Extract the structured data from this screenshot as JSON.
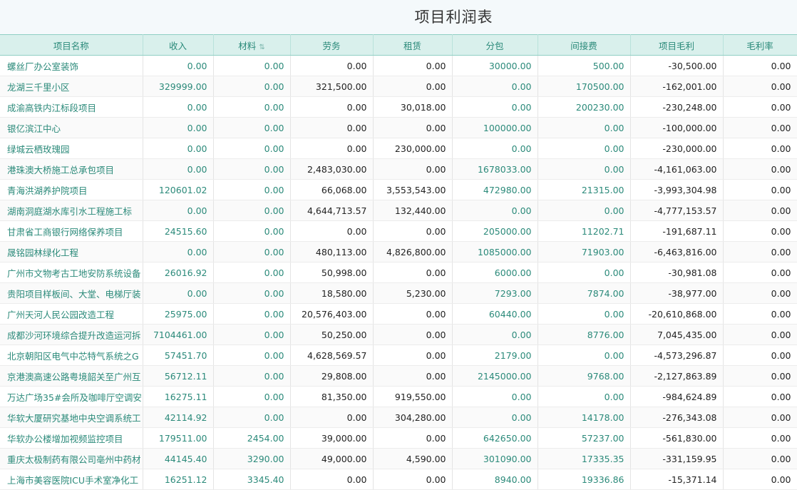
{
  "page": {
    "title": "项目利润表"
  },
  "columns": [
    {
      "key": "name",
      "label": "项目名称"
    },
    {
      "key": "income",
      "label": "收入"
    },
    {
      "key": "material",
      "label": "材料",
      "sort_icon": "sort-icon"
    },
    {
      "key": "labor",
      "label": "劳务"
    },
    {
      "key": "lease",
      "label": "租赁"
    },
    {
      "key": "subcontract",
      "label": "分包"
    },
    {
      "key": "indirect",
      "label": "间接费"
    },
    {
      "key": "gross",
      "label": "项目毛利"
    },
    {
      "key": "margin",
      "label": "毛利率"
    }
  ],
  "rows": [
    {
      "name": "螺丝厂办公室装饰",
      "income": "0.00",
      "material": "0.00",
      "labor": "0.00",
      "lease": "0.00",
      "subcontract": "30000.00",
      "indirect": "500.00",
      "gross": "-30,500.00",
      "margin": "0.00"
    },
    {
      "name": "龙湖三千里小区",
      "income": "329999.00",
      "material": "0.00",
      "labor": "321,500.00",
      "lease": "0.00",
      "subcontract": "0.00",
      "indirect": "170500.00",
      "gross": "-162,001.00",
      "margin": "0.00"
    },
    {
      "name": "成渝高铁内江标段项目",
      "income": "0.00",
      "material": "0.00",
      "labor": "0.00",
      "lease": "30,018.00",
      "subcontract": "0.00",
      "indirect": "200230.00",
      "gross": "-230,248.00",
      "margin": "0.00"
    },
    {
      "name": "银亿滨江中心",
      "income": "0.00",
      "material": "0.00",
      "labor": "0.00",
      "lease": "0.00",
      "subcontract": "100000.00",
      "indirect": "0.00",
      "gross": "-100,000.00",
      "margin": "0.00"
    },
    {
      "name": "绿城云栖玫瑰园",
      "income": "0.00",
      "material": "0.00",
      "labor": "0.00",
      "lease": "230,000.00",
      "subcontract": "0.00",
      "indirect": "0.00",
      "gross": "-230,000.00",
      "margin": "0.00"
    },
    {
      "name": "港珠澳大桥施工总承包项目",
      "income": "0.00",
      "material": "0.00",
      "labor": "2,483,030.00",
      "lease": "0.00",
      "subcontract": "1678033.00",
      "indirect": "0.00",
      "gross": "-4,161,063.00",
      "margin": "0.00"
    },
    {
      "name": "青海洪湖养护院项目",
      "income": "120601.02",
      "material": "0.00",
      "labor": "66,068.00",
      "lease": "3,553,543.00",
      "subcontract": "472980.00",
      "indirect": "21315.00",
      "gross": "-3,993,304.98",
      "margin": "0.00"
    },
    {
      "name": "湖南洞庭湖水库引水工程施工标",
      "income": "0.00",
      "material": "0.00",
      "labor": "4,644,713.57",
      "lease": "132,440.00",
      "subcontract": "0.00",
      "indirect": "0.00",
      "gross": "-4,777,153.57",
      "margin": "0.00"
    },
    {
      "name": "甘肃省工商银行网络保养项目",
      "income": "24515.60",
      "material": "0.00",
      "labor": "0.00",
      "lease": "0.00",
      "subcontract": "205000.00",
      "indirect": "11202.71",
      "gross": "-191,687.11",
      "margin": "0.00"
    },
    {
      "name": "晟铭园林绿化工程",
      "income": "0.00",
      "material": "0.00",
      "labor": "480,113.00",
      "lease": "4,826,800.00",
      "subcontract": "1085000.00",
      "indirect": "71903.00",
      "gross": "-6,463,816.00",
      "margin": "0.00"
    },
    {
      "name": "广州市文物考古工地安防系统设备",
      "income": "26016.92",
      "material": "0.00",
      "labor": "50,998.00",
      "lease": "0.00",
      "subcontract": "6000.00",
      "indirect": "0.00",
      "gross": "-30,981.08",
      "margin": "0.00"
    },
    {
      "name": "贵阳项目样板间、大堂、电梯厅装",
      "income": "0.00",
      "material": "0.00",
      "labor": "18,580.00",
      "lease": "5,230.00",
      "subcontract": "7293.00",
      "indirect": "7874.00",
      "gross": "-38,977.00",
      "margin": "0.00"
    },
    {
      "name": "广州天河人民公园改造工程",
      "income": "25975.00",
      "material": "0.00",
      "labor": "20,576,403.00",
      "lease": "0.00",
      "subcontract": "60440.00",
      "indirect": "0.00",
      "gross": "-20,610,868.00",
      "margin": "0.00"
    },
    {
      "name": "成都沙河环境综合提升改造运河拆",
      "income": "7104461.00",
      "material": "0.00",
      "labor": "50,250.00",
      "lease": "0.00",
      "subcontract": "0.00",
      "indirect": "8776.00",
      "gross": "7,045,435.00",
      "margin": "0.00"
    },
    {
      "name": "北京朝阳区电气中芯特气系统之G",
      "income": "57451.70",
      "material": "0.00",
      "labor": "4,628,569.57",
      "lease": "0.00",
      "subcontract": "2179.00",
      "indirect": "0.00",
      "gross": "-4,573,296.87",
      "margin": "0.00"
    },
    {
      "name": "京港澳高速公路粤境韶关至广州互",
      "income": "56712.11",
      "material": "0.00",
      "labor": "29,808.00",
      "lease": "0.00",
      "subcontract": "2145000.00",
      "indirect": "9768.00",
      "gross": "-2,127,863.89",
      "margin": "0.00"
    },
    {
      "name": "万达广场35#会所及咖啡厅空调安",
      "income": "16275.11",
      "material": "0.00",
      "labor": "81,350.00",
      "lease": "919,550.00",
      "subcontract": "0.00",
      "indirect": "0.00",
      "gross": "-984,624.89",
      "margin": "0.00"
    },
    {
      "name": "华软大厦研究基地中央空调系统工",
      "income": "42114.92",
      "material": "0.00",
      "labor": "0.00",
      "lease": "304,280.00",
      "subcontract": "0.00",
      "indirect": "14178.00",
      "gross": "-276,343.08",
      "margin": "0.00"
    },
    {
      "name": "华软办公楼增加视频监控项目",
      "income": "179511.00",
      "material": "2454.00",
      "labor": "39,000.00",
      "lease": "0.00",
      "subcontract": "642650.00",
      "indirect": "57237.00",
      "gross": "-561,830.00",
      "margin": "0.00"
    },
    {
      "name": "重庆太极制药有限公司亳州中药材",
      "income": "44145.40",
      "material": "3290.00",
      "labor": "49,000.00",
      "lease": "4,590.00",
      "subcontract": "301090.00",
      "indirect": "17335.35",
      "gross": "-331,159.95",
      "margin": "0.00"
    },
    {
      "name": "上海市美容医院ICU手术室净化工",
      "income": "16251.12",
      "material": "3345.40",
      "labor": "0.00",
      "lease": "0.00",
      "subcontract": "8940.00",
      "indirect": "19336.86",
      "gross": "-15,371.14",
      "margin": "0.00"
    }
  ]
}
